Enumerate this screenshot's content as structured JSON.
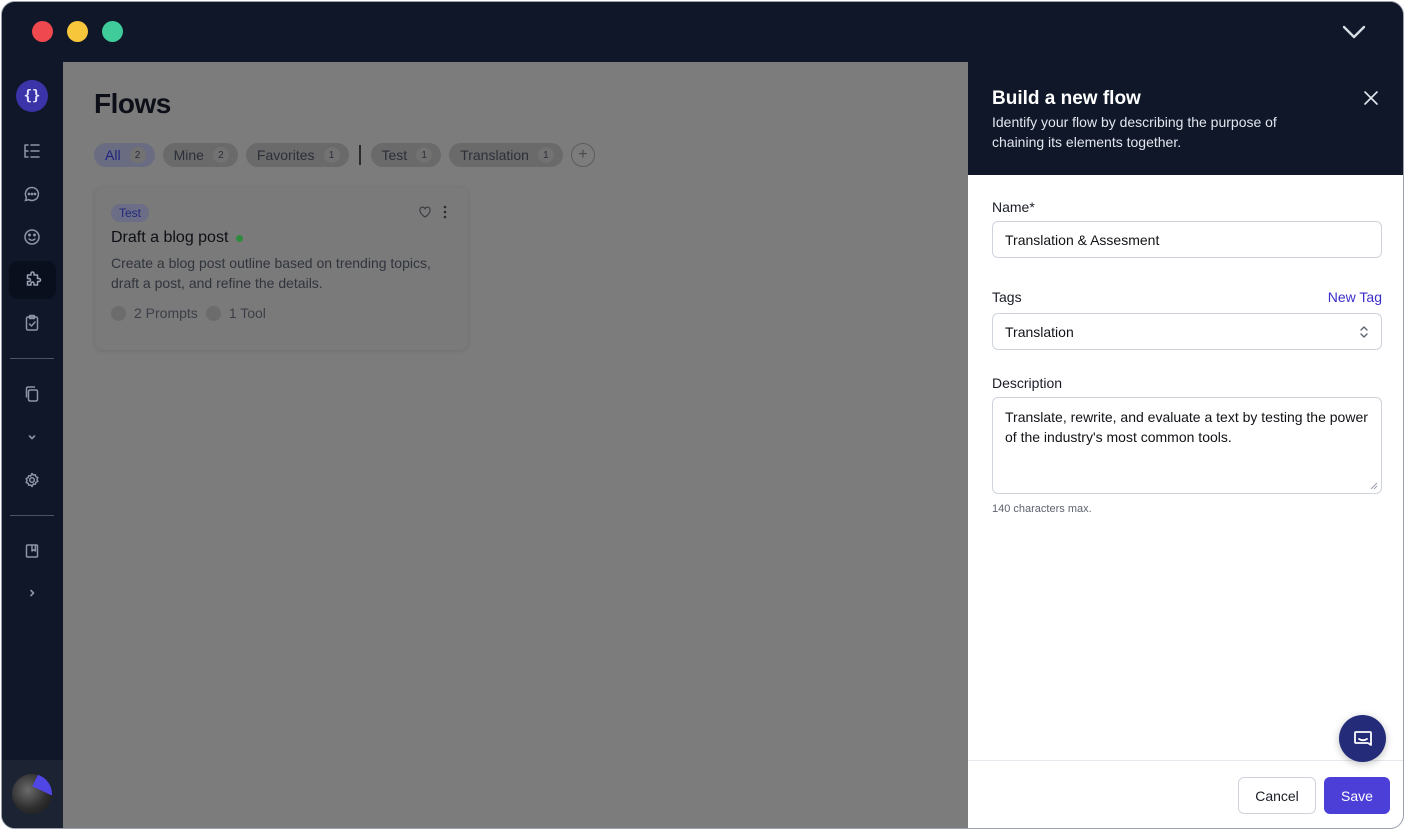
{
  "window": {
    "controls": [
      "close",
      "minimize",
      "maximize"
    ],
    "menu_icon": "chevron-down-icon"
  },
  "sidebar": {
    "logo": "{}",
    "items": [
      {
        "icon": "list-tree-icon",
        "active": false
      },
      {
        "icon": "chat-icon",
        "active": false
      },
      {
        "icon": "smiley-icon",
        "active": false
      },
      {
        "icon": "puzzle-icon",
        "active": true
      },
      {
        "icon": "clipboard-check-icon",
        "active": false
      },
      {
        "icon": "copy-icon",
        "active": false
      },
      {
        "icon": "chevron-down-icon",
        "active": false
      },
      {
        "icon": "gear-icon",
        "active": false
      },
      {
        "icon": "book-icon",
        "active": false
      },
      {
        "icon": "chevron-right-icon",
        "active": false
      }
    ]
  },
  "main": {
    "title": "Flows",
    "filters": [
      {
        "label": "All",
        "count": "2",
        "selected": true
      },
      {
        "label": "Mine",
        "count": "2",
        "selected": false
      },
      {
        "label": "Favorites",
        "count": "1",
        "selected": false
      }
    ],
    "tag_filters": [
      {
        "label": "Test",
        "count": "1"
      },
      {
        "label": "Translation",
        "count": "1"
      }
    ],
    "add_filter": "+",
    "cards": [
      {
        "tag": "Test",
        "title": "Draft a blog post",
        "description": "Create a blog post outline based on trending topics, draft a post, and refine the details.",
        "prompts": "2 Prompts",
        "tools": "1 Tool"
      }
    ]
  },
  "panel": {
    "title": "Build a new flow",
    "subtitle": "Identify your flow by describing the purpose of chaining its elements together.",
    "name_label": "Name*",
    "name_value": "Translation & Assesment",
    "tags_label": "Tags",
    "new_tag_label": "New Tag",
    "tags_value": "Translation",
    "description_label": "Description",
    "description_value": "Translate, rewrite, and evaluate a text by testing the power of the industry's most common tools.",
    "description_hint": "140 characters max.",
    "cancel_label": "Cancel",
    "save_label": "Save"
  },
  "colors": {
    "titlebar": "#0f1729",
    "overlay": "#7c7c7c",
    "primary": "#4b3fd8",
    "link": "#3a2fc9",
    "status_active": "#2e8b3e"
  }
}
